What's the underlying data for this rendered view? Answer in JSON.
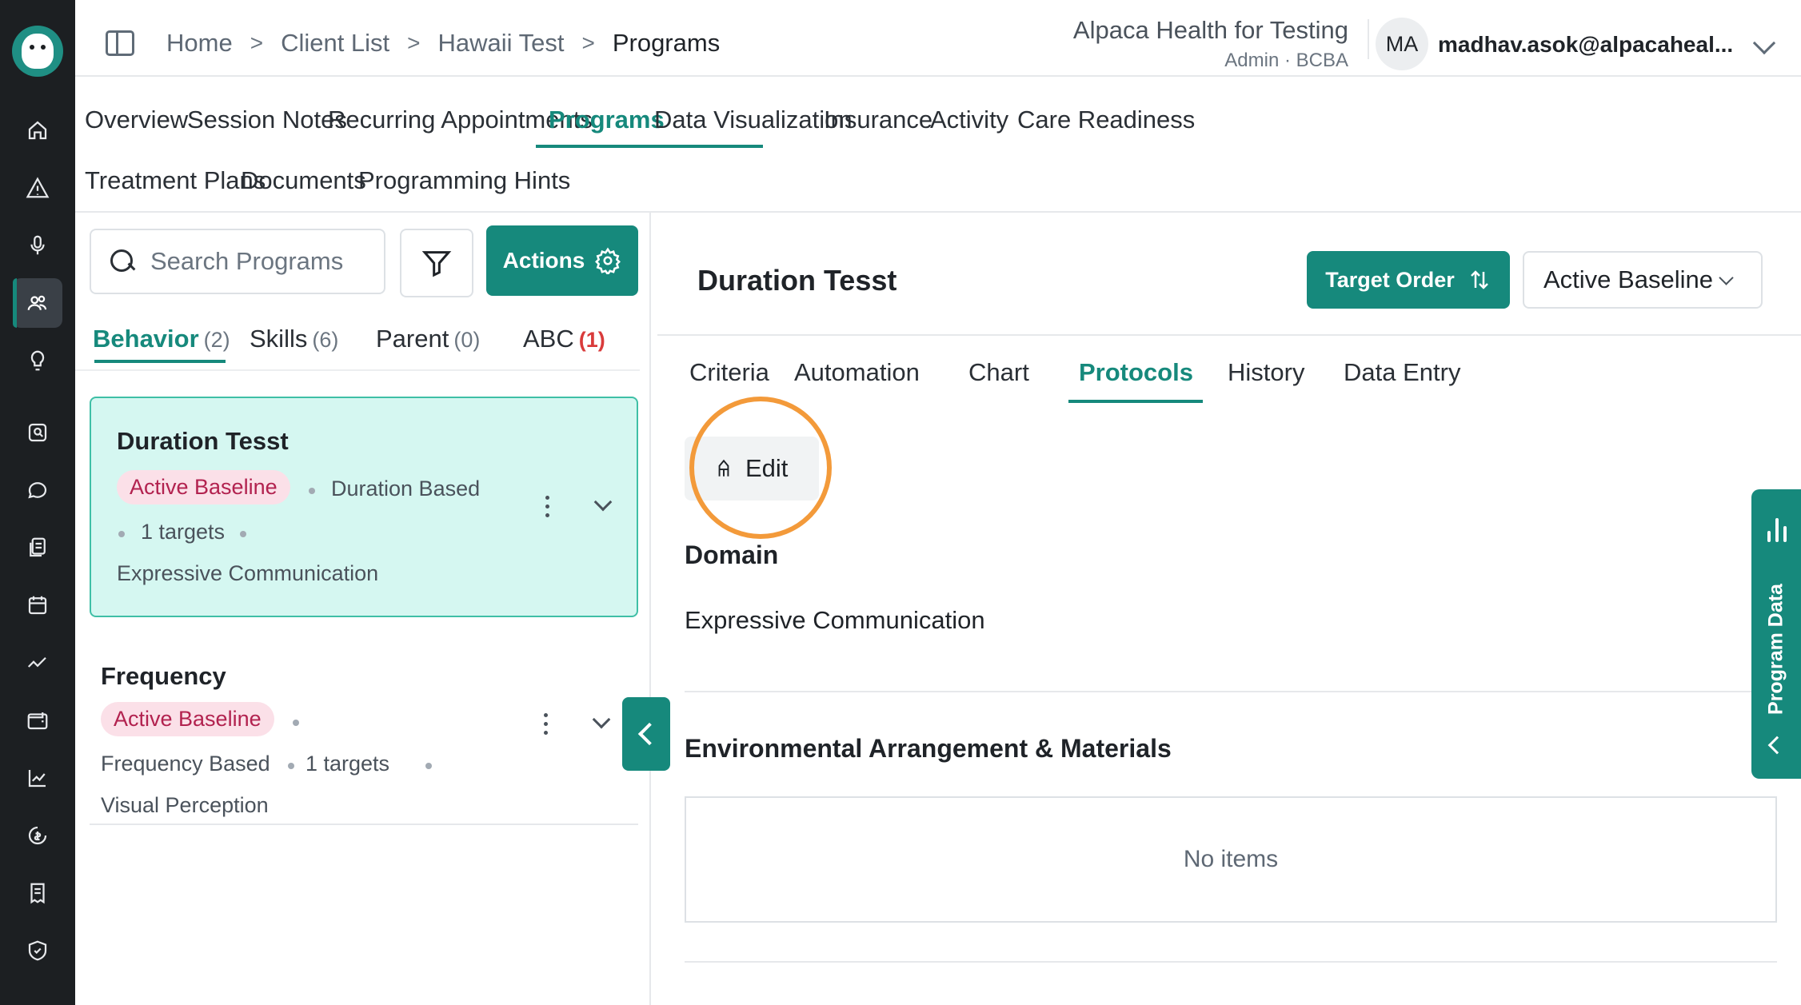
{
  "header": {
    "breadcrumb": [
      "Home",
      "Client List",
      "Hawaii Test",
      "Programs"
    ],
    "breadcrumb_separator": ">",
    "org_name": "Alpaca Health for Testing",
    "org_role": "Admin · BCBA",
    "avatar_initials": "MA",
    "user_email": "madhav.asok@alpacaheal..."
  },
  "main_tabs": {
    "row1": [
      "Overview",
      "Session Notes",
      "Recurring Appointments",
      "Programs",
      "Data Visualization",
      "Insurance",
      "Activity",
      "Care Readiness"
    ],
    "row2": [
      "Treatment Plans",
      "Documents",
      "Programming Hints"
    ],
    "active": "Programs"
  },
  "left_panel": {
    "search_placeholder": "Search Programs",
    "actions_label": "Actions",
    "categories": [
      {
        "label": "Behavior",
        "count": "(2)"
      },
      {
        "label": "Skills",
        "count": "(6)"
      },
      {
        "label": "Parent",
        "count": "(0)"
      },
      {
        "label": "ABC",
        "count": "(1)"
      }
    ],
    "programs": [
      {
        "title": "Duration Tesst",
        "status": "Active Baseline",
        "type": "Duration Based",
        "targets": "1 targets",
        "domain": "Expressive Communication"
      },
      {
        "title": "Frequency",
        "status": "Active Baseline",
        "type": "Frequency Based",
        "targets": "1 targets",
        "domain": "Visual Perception"
      }
    ]
  },
  "detail": {
    "title": "Duration Tesst",
    "target_order_label": "Target Order",
    "status_value": "Active Baseline",
    "tabs": [
      "Criteria",
      "Automation",
      "Chart",
      "Protocols",
      "History",
      "Data Entry"
    ],
    "active_tab": "Protocols",
    "edit_label": "Edit",
    "domain_heading": "Domain",
    "domain_value": "Expressive Communication",
    "env_heading": "Environmental Arrangement & Materials",
    "env_empty": "No items"
  },
  "side_drawer": {
    "label": "Program Data"
  },
  "colors": {
    "accent": "#16897c",
    "selected_card": "#d5f7f1",
    "badge_bg": "#fbe0e8",
    "badge_text": "#b2224f",
    "highlight": "#f39a3a",
    "rail": "#1c1f22"
  }
}
